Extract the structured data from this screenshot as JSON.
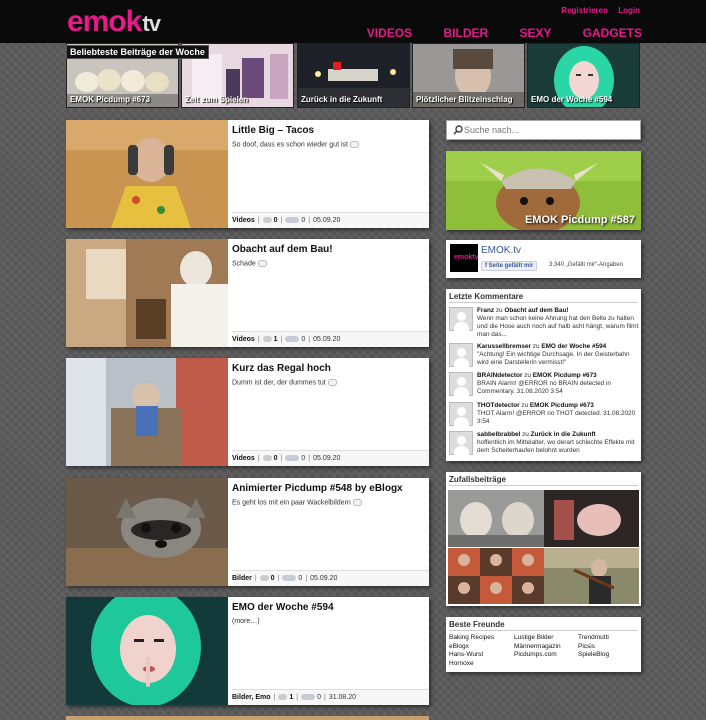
{
  "header": {
    "logo_main": "emok",
    "logo_suffix": "tv",
    "top_links": [
      "Registrieren",
      "Login"
    ],
    "nav": [
      "VIDEOS",
      "BILDER",
      "SEXY",
      "GADGETS"
    ]
  },
  "featured": {
    "title": "Beliebteste Beiträge der Woche",
    "items": [
      {
        "caption": "EMOK Picdump #673"
      },
      {
        "caption": "Zeit zum Spielen"
      },
      {
        "caption": "Zurück in die Zukunft"
      },
      {
        "caption": "Plötzlicher Blitzeinschlag"
      },
      {
        "caption": "EMO der Woche #594"
      }
    ]
  },
  "posts": [
    {
      "title": "Little Big – Tacos",
      "desc": "So doof, dass es schon wieder gut ist",
      "category": "Videos",
      "comments": "0",
      "likes": "0",
      "date": "05.09.20"
    },
    {
      "title": "Obacht auf dem Bau!",
      "desc": "Schade",
      "category": "Videos",
      "comments": "1",
      "likes": "0",
      "date": "05.09.20"
    },
    {
      "title": "Kurz das Regal hoch",
      "desc": "Dumm ist der, der dummes tut",
      "category": "Videos",
      "comments": "0",
      "likes": "0",
      "date": "05.09.20"
    },
    {
      "title": "Animierter Picdump #548 by eBlogx",
      "desc": "Es geht los mit ein paar Wackelbildern",
      "category": "Bilder",
      "comments": "0",
      "likes": "0",
      "date": "05.09.20"
    },
    {
      "title": "EMO der Woche #594",
      "desc": "(more…)",
      "category": "Bilder, Emo",
      "comments": "1",
      "likes": "0",
      "date": "31.08.20"
    }
  ],
  "search": {
    "placeholder": "Suche nach..."
  },
  "promo": {
    "caption": "EMOK Picdump #587"
  },
  "facebook": {
    "page_name": "EMOK.tv",
    "like_label": "Seite gefällt mir",
    "likes_text": "3.340 „Gefällt mir“-Angaben",
    "logo_text": "emoktv"
  },
  "comments_box": {
    "title": "Letzte Kommentare",
    "items": [
      {
        "author": "Franz",
        "zu": "zu",
        "post": "Obacht auf dem Bau!",
        "text": "Wenn man schon keine Ahnung hat den Bello zu halten und die Hose auch noch auf halb acht hängt, warum filmt man das..."
      },
      {
        "author": "Karussellbremser",
        "zu": "zu",
        "post": "EMO der Woche #594",
        "text": "\"Achtung! Ein wichtige Durchsage. In der Geisterbahn wird eine Darstellerin vermisst!\""
      },
      {
        "author": "BRAINdetector",
        "zu": "zu",
        "post": "EMOK Picdump #673",
        "text": "BRAIN Alarm! @ERROR no BRAIN detected in Commentary. 31.08.2020 3:54"
      },
      {
        "author": "THOTdetector",
        "zu": "zu",
        "post": "EMOK Picdump #673",
        "text": "THOT Alarm! @ERROR no THOT detected. 31.08.2020 3:54"
      },
      {
        "author": "sabbelbrabbel",
        "zu": "zu",
        "post": "Zurück in die Zukunft",
        "text": "hoffentlich im Mittelalter, wo derart schlechte Effekte mit dem Scheiterhaufen belohnt wurden"
      }
    ]
  },
  "random_box": {
    "title": "Zufallsbeiträge"
  },
  "friends_box": {
    "title": "Beste Freunde",
    "col1": [
      "Baking Recipes",
      "eBlogx",
      "Hans-Wurst",
      "Hornoxe"
    ],
    "col2": [
      "Lustige Bilder",
      "Männermagazin",
      "Picdumps.com"
    ],
    "col3": [
      "Trendmutti",
      "Picsis",
      "SpieleBlog"
    ]
  },
  "colors": {
    "accent": "#e8198b",
    "header_bg": "#0a0a0a",
    "page_bg": "#5b5b5b"
  }
}
